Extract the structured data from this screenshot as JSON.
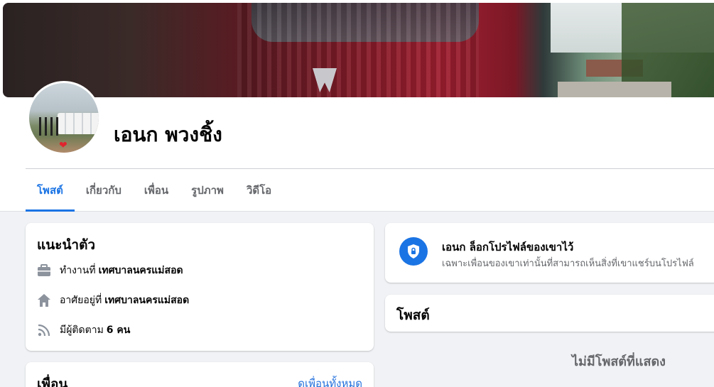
{
  "profile": {
    "name": "เอนก พวงชิ้ง"
  },
  "tabs": [
    {
      "label": "โพสต์",
      "active": true
    },
    {
      "label": "เกี่ยวกับ",
      "active": false
    },
    {
      "label": "เพื่อน",
      "active": false
    },
    {
      "label": "รูปภาพ",
      "active": false
    },
    {
      "label": "วิดีโอ",
      "active": false
    }
  ],
  "intro": {
    "title": "แนะนำตัว",
    "work_prefix": "ทำงานที่",
    "work_value": "เทศบาลนครแม่สอด",
    "home_prefix": "อาศัยอยู่ที่",
    "home_value": "เทศบาลนครแม่สอด",
    "followers_prefix": "มีผู้ติดตาม",
    "followers_value": "6 คน"
  },
  "friends": {
    "title": "เพื่อน",
    "see_all": "ดูเพื่อนทั้งหมด"
  },
  "locked_notice": {
    "title": "เอนก ล็อกโปรไฟล์ของเขาไว้",
    "subtitle": "เฉพาะเพื่อนของเขาเท่านั้นที่สามารถเห็นสิ่งที่เขาแชร์บนโปรไฟล์"
  },
  "posts": {
    "title": "โพสต์",
    "empty": "ไม่มีโพสต์ที่แสดง"
  },
  "colors": {
    "accent": "#1b74e4",
    "background": "#f0f2f5",
    "secondary_text": "#65676b"
  },
  "icons": [
    "briefcase-icon",
    "home-icon",
    "rss-feed-icon",
    "shield-lock-icon"
  ]
}
